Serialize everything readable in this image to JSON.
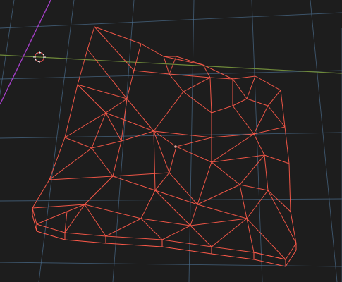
{
  "viewport": {
    "background": "#1d1d1d",
    "grid_color": "#4a6b8a",
    "x_axis_color": "#6f8a3a",
    "y_axis_color": "#a23ec4",
    "wire_color": "#ff5a4a",
    "wire_highlight_color": "#ff8c7a"
  },
  "objects": [
    {
      "name": "terrain-mesh",
      "display": "wireframe",
      "selected": true
    },
    {
      "name": "3d-cursor",
      "icon": "crosshair-circle-icon"
    }
  ]
}
